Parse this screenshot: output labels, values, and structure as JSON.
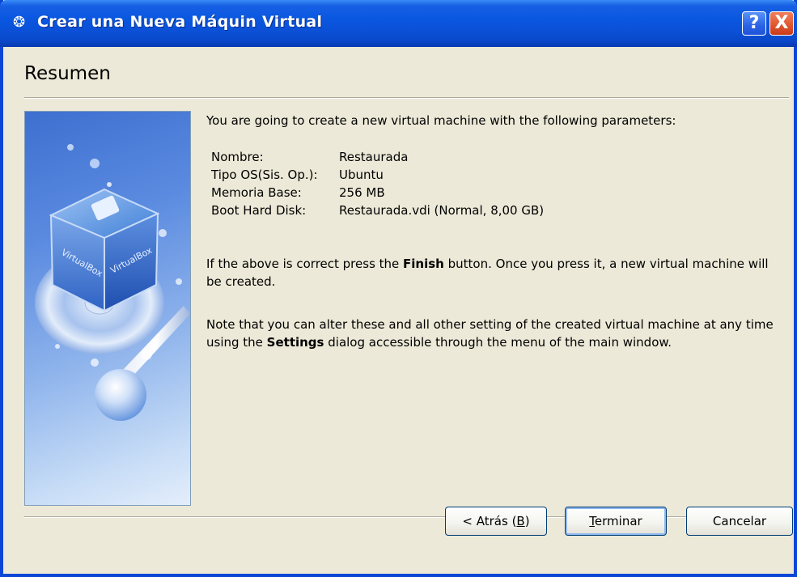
{
  "window": {
    "title": "Crear una Nueva Máquin Virtual",
    "help_label": "?",
    "close_label": "X"
  },
  "page": {
    "title": "Resumen",
    "intro": "You are going to create a new virtual machine with the following parameters:",
    "params": [
      {
        "key": "Nombre:",
        "value": "Restaurada"
      },
      {
        "key": "Tipo OS(Sis. Op.):",
        "value": "Ubuntu"
      },
      {
        "key": "Memoria Base:",
        "value": "256 MB"
      },
      {
        "key": "Boot Hard Disk:",
        "value": "Restaurada.vdi (Normal, 8,00 GB)"
      }
    ],
    "finish_text_1": "If the above is correct press the ",
    "finish_bold": "Finish",
    "finish_text_2": " button. Once you press it, a new virtual machine will be created.",
    "note_text_1": "Note that you can alter these and all other setting of the created virtual machine at any time using the ",
    "note_bold": "Settings",
    "note_text_2": " dialog accessible through the menu of the main window."
  },
  "buttons": {
    "back_prefix": "< Atrás (",
    "back_key": "B",
    "back_suffix": ")",
    "finish_key": "T",
    "finish_rest": "erminar",
    "cancel": "Cancelar"
  },
  "image": {
    "cube_face_label_left": "VirtualBox",
    "cube_face_label_right": "VirtualBox"
  }
}
